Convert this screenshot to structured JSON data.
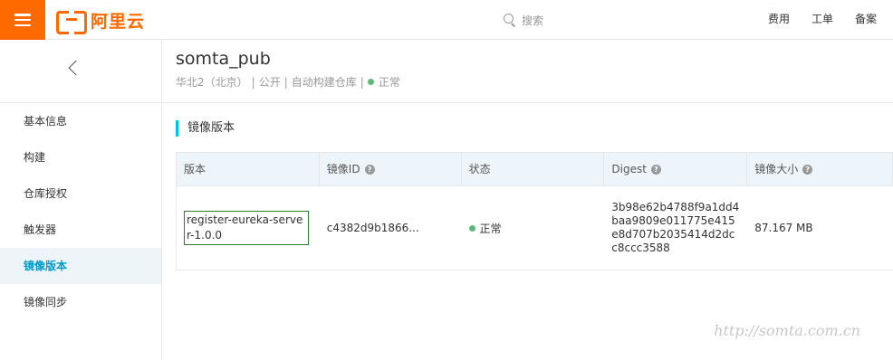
{
  "topbar": {
    "logo_text": "阿里云",
    "search_placeholder": "搜索",
    "links": [
      "费用",
      "工单",
      "备案"
    ],
    "accent_color": "#ff6a00"
  },
  "sidebar": {
    "back_icon": "chevron-left-icon",
    "items": [
      {
        "label": "基本信息",
        "active": false
      },
      {
        "label": "构建",
        "active": false
      },
      {
        "label": "仓库授权",
        "active": false
      },
      {
        "label": "触发器",
        "active": false
      },
      {
        "label": "镜像版本",
        "active": true
      },
      {
        "label": "镜像同步",
        "active": false
      }
    ]
  },
  "header": {
    "repo_name": "somta_pub",
    "region": "华北2（北京）",
    "visibility": "公开",
    "build_type": "自动构建仓库",
    "status": "正常"
  },
  "section": {
    "title": "镜像版本"
  },
  "table": {
    "columns": [
      "版本",
      "镜像ID",
      "状态",
      "Digest",
      "镜像大小"
    ],
    "rows": [
      {
        "version": "register-eureka-server-1.0.0",
        "image_id": "c4382d9b1866...",
        "status": "正常",
        "digest": "3b98e62b4788f9a1dd4baa9809e011775e415e8d707b2035414d2dcc8ccc3588",
        "size": "87.167 MB"
      }
    ]
  },
  "watermark": "http://somta.com.cn",
  "colors": {
    "status_ok": "#5fb878",
    "active_nav": "#0099cc",
    "section_bar": "#00c1de"
  }
}
